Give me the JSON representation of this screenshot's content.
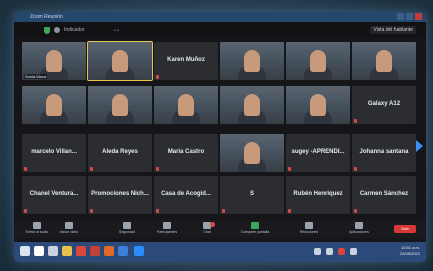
{
  "window": {
    "title": "Zoom Reunión"
  },
  "topbar": {
    "meeting_label": "Indicador",
    "view_button": "Vista del hablante"
  },
  "participants": [
    {
      "name": "Sonia Maca",
      "row": 0
    },
    {
      "name": "",
      "row": 0
    },
    {
      "name": "Karen Muñoz",
      "row": 0
    },
    {
      "name": "",
      "row": 0
    },
    {
      "name": "",
      "row": 0
    },
    {
      "name": "",
      "row": 0
    },
    {
      "name": "",
      "row": 1
    },
    {
      "name": "",
      "row": 1
    },
    {
      "name": "",
      "row": 1
    },
    {
      "name": "",
      "row": 1
    },
    {
      "name": "",
      "row": 1
    },
    {
      "name": "Galaxy A12",
      "row": 1
    },
    {
      "name": "marcelo Villan...",
      "row": 2
    },
    {
      "name": "Aleda Reyes",
      "row": 2
    },
    {
      "name": "Maria Castro",
      "row": 2
    },
    {
      "name": "",
      "row": 2
    },
    {
      "name": "sugey -APRENDI...",
      "row": 2
    },
    {
      "name": "Johanna santana",
      "row": 2
    },
    {
      "name": "Chanel Ventura...",
      "row": 3
    },
    {
      "name": "Promociones Nich...",
      "row": 3
    },
    {
      "name": "Casa de Acogid...",
      "row": 3
    },
    {
      "name": "S",
      "row": 3
    },
    {
      "name": "Rubén Henriquez",
      "row": 3
    },
    {
      "name": "Carmen Sánchez",
      "row": 3
    }
  ],
  "toolbar": {
    "items": [
      {
        "label": "Entrar al audio"
      },
      {
        "label": "Iniciar video"
      },
      {
        "label": "Seguridad"
      },
      {
        "label": "Participantes"
      },
      {
        "label": "Chat"
      },
      {
        "label": "Compartir pantalla"
      },
      {
        "label": "Reacciones"
      },
      {
        "label": "Aplicaciones"
      }
    ],
    "end_label": "Salir",
    "participant_count": "25"
  },
  "taskbar": {
    "time": "10:51 a.m.",
    "date": "22/09/2022"
  },
  "colors": {
    "accent": "#3a8ff0",
    "end": "#d93838",
    "taskbar": "#2b4a7a"
  }
}
